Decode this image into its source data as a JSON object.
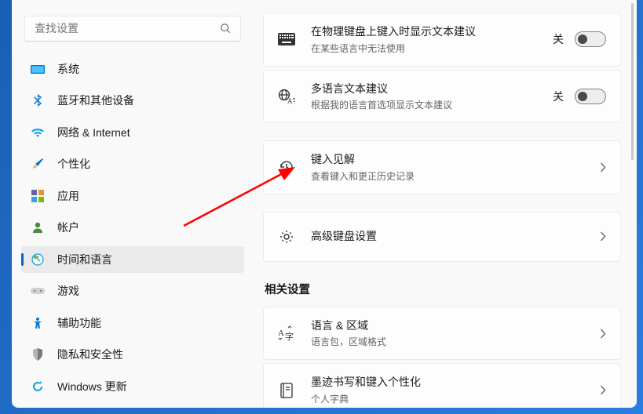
{
  "search": {
    "placeholder": "查找设置"
  },
  "sidebar": {
    "items": [
      {
        "label": "系统"
      },
      {
        "label": "蓝牙和其他设备"
      },
      {
        "label": "网络 & Internet"
      },
      {
        "label": "个性化"
      },
      {
        "label": "应用"
      },
      {
        "label": "帐户"
      },
      {
        "label": "时间和语言"
      },
      {
        "label": "游戏"
      },
      {
        "label": "辅助功能"
      },
      {
        "label": "隐私和安全性"
      },
      {
        "label": "Windows 更新"
      }
    ]
  },
  "cards": {
    "c0": {
      "title": "在物理键盘上键入时显示文本建议",
      "sub": "在某些语言中无法使用",
      "state": "关"
    },
    "c1": {
      "title": "多语言文本建议",
      "sub": "根据我的语言首选项显示文本建议",
      "state": "关"
    },
    "c2": {
      "title": "键入见解",
      "sub": "查看键入和更正历史记录"
    },
    "c3": {
      "title": "高级键盘设置"
    },
    "c4": {
      "title": "语言 & 区域",
      "sub": "语言包，区域格式"
    },
    "c5": {
      "title": "墨迹书写和键入个性化",
      "sub": "个人字典"
    }
  },
  "sections": {
    "related": "相关设置"
  }
}
